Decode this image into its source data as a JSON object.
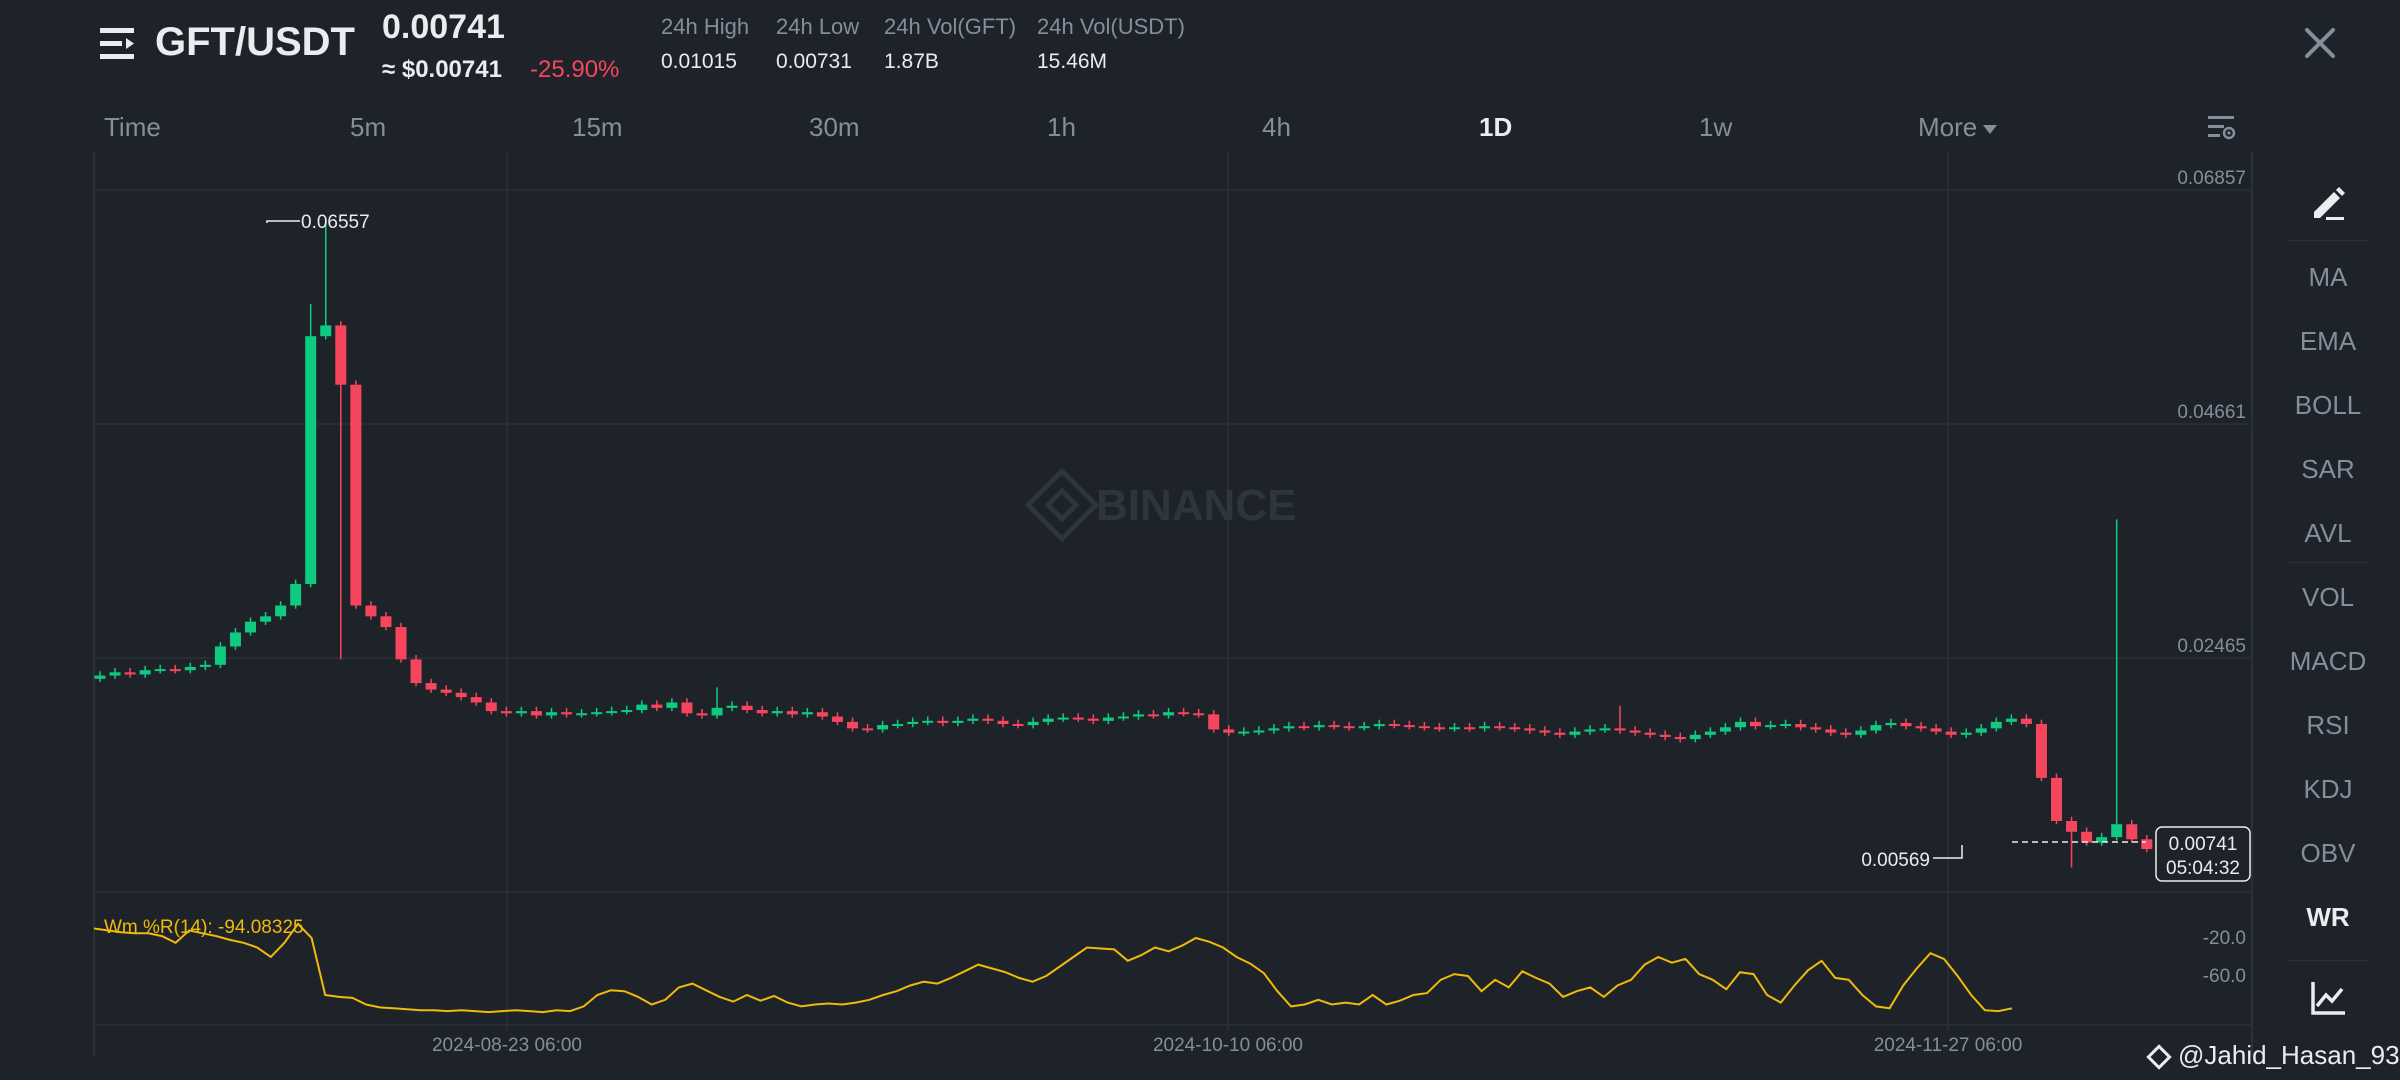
{
  "header": {
    "pair": "GFT/USDT",
    "last_price": "0.00741",
    "usd_price": "≈ $0.00741",
    "change": "-25.90%",
    "stats": [
      {
        "label": "24h High",
        "value": "0.01015"
      },
      {
        "label": "24h Low",
        "value": "0.00731"
      },
      {
        "label": "24h Vol(GFT)",
        "value": "1.87B"
      },
      {
        "label": "24h Vol(USDT)",
        "value": "15.46M"
      }
    ]
  },
  "tabs": [
    {
      "label": "Time",
      "active": false
    },
    {
      "label": "5m",
      "active": false
    },
    {
      "label": "15m",
      "active": false
    },
    {
      "label": "30m",
      "active": false
    },
    {
      "label": "1h",
      "active": false
    },
    {
      "label": "4h",
      "active": false
    },
    {
      "label": "1D",
      "active": true
    },
    {
      "label": "1w",
      "active": false
    },
    {
      "label": "More",
      "active": false
    }
  ],
  "sidebar": {
    "items": [
      "MA",
      "EMA",
      "BOLL",
      "SAR",
      "AVL",
      "VOL",
      "MACD",
      "RSI",
      "KDJ",
      "OBV",
      "WR"
    ],
    "active": "WR"
  },
  "chart": {
    "watermark": "BINANCE",
    "price_axis": [
      "0.06857",
      "0.04661",
      "0.02465"
    ],
    "high_label": "0.06557",
    "low_label": "0.00569",
    "last_price": "0.00741",
    "countdown": "05:04:32",
    "x_labels": [
      "2024-08-23 06:00",
      "2024-10-10 06:00",
      "2024-11-27 06:00"
    ],
    "indicator_label": "Wm %R(14): -94.08325",
    "indicator_axis": [
      "-20.0",
      "-60.0"
    ]
  },
  "colors": {
    "up": "#0ecb81",
    "down": "#f6465d",
    "wr_line": "#f0b90b",
    "bg": "#1e2329"
  },
  "credit": "@Jahid_Hasan_93"
}
